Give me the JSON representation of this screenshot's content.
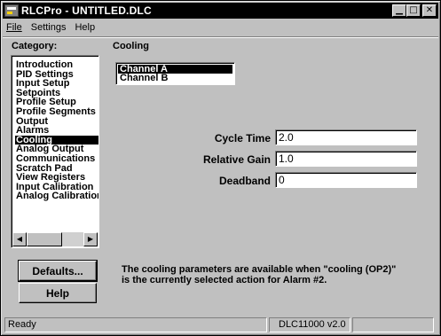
{
  "window": {
    "title": "RLCPro - UNTITLED.DLC",
    "minimize_glyph": "▁",
    "maximize_glyph": "□",
    "close_glyph": "✕"
  },
  "menu": {
    "file": "File",
    "settings": "Settings",
    "help": "Help"
  },
  "sidebar": {
    "label": "Category:",
    "items": [
      {
        "label": "Introduction",
        "selected": false
      },
      {
        "label": "PID Settings",
        "selected": false
      },
      {
        "label": "Input Setup",
        "selected": false
      },
      {
        "label": "Setpoints",
        "selected": false
      },
      {
        "label": "Profile Setup",
        "selected": false
      },
      {
        "label": "Profile Segments",
        "selected": false
      },
      {
        "label": "Output",
        "selected": false
      },
      {
        "label": "Alarms",
        "selected": false
      },
      {
        "label": "Cooling",
        "selected": true
      },
      {
        "label": "Analog Output",
        "selected": false
      },
      {
        "label": "Communications",
        "selected": false
      },
      {
        "label": "Scratch Pad",
        "selected": false
      },
      {
        "label": "View Registers",
        "selected": false
      },
      {
        "label": "Input Calibration",
        "selected": false
      },
      {
        "label": "Analog Calibration",
        "selected": false
      }
    ],
    "scroll_left_glyph": "◀",
    "scroll_right_glyph": "▶"
  },
  "buttons": {
    "defaults": "Defaults...",
    "help": "Help"
  },
  "main": {
    "section_title": "Cooling",
    "channels": [
      {
        "label": "Channel A",
        "selected": true
      },
      {
        "label": "Channel B",
        "selected": false
      }
    ],
    "fields": {
      "cycle_time": {
        "label": "Cycle Time",
        "value": "2.0"
      },
      "relative_gain": {
        "label": "Relative Gain",
        "value": "1.0"
      },
      "deadband": {
        "label": "Deadband",
        "value": "0"
      }
    },
    "info_line1": "The cooling parameters are available when \"cooling (OP2)\"",
    "info_line2": "is the currently selected action for Alarm #2."
  },
  "status": {
    "message": "Ready",
    "version": "DLC11000 v2.0",
    "extra": ""
  },
  "colors": {
    "selection": "#000000",
    "face": "#c0c0c0"
  }
}
